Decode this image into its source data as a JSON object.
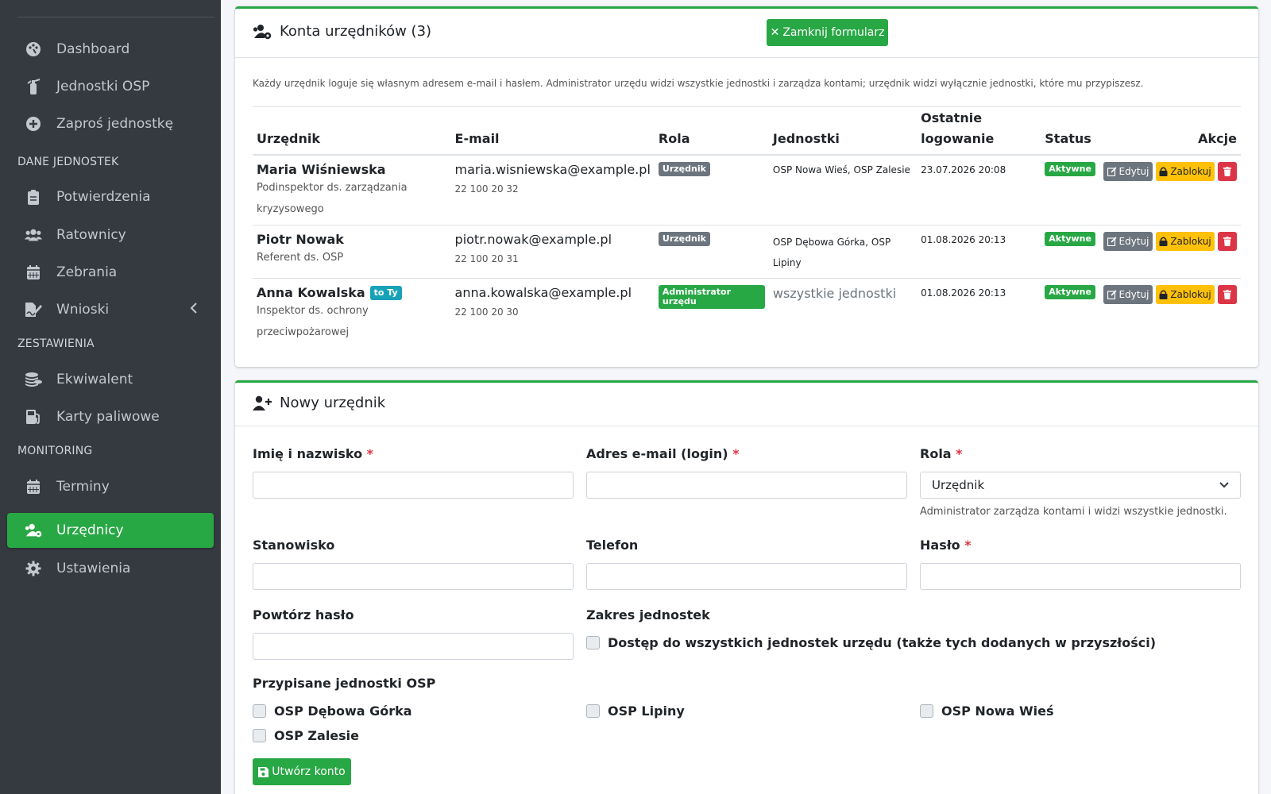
{
  "sidebar": {
    "items": [
      {
        "label": "Dashboard",
        "icon": "palette-icon"
      },
      {
        "label": "Jednostki OSP",
        "icon": "fire-extinguisher-icon"
      },
      {
        "label": "Zaproś jednostkę",
        "icon": "plus-circle-icon"
      },
      {
        "label": "Potwierdzenia",
        "icon": "clipboard-icon"
      },
      {
        "label": "Ratownicy",
        "icon": "users-icon"
      },
      {
        "label": "Zebrania",
        "icon": "calendar-icon"
      },
      {
        "label": "Wnioski",
        "icon": "file-signature-icon"
      },
      {
        "label": "Ekwiwalent",
        "icon": "coins-icon"
      },
      {
        "label": "Karty paliwowe",
        "icon": "gas-pump-icon"
      },
      {
        "label": "Terminy",
        "icon": "calendar-icon"
      },
      {
        "label": "Urzędnicy",
        "icon": "users-cog-icon"
      },
      {
        "label": "Ustawienia",
        "icon": "gear-icon"
      }
    ],
    "headers": [
      "DANE JEDNOSTEK",
      "ZESTAWIENIA",
      "MONITORING"
    ],
    "active_item": "Urzędnicy"
  },
  "accounts_card": {
    "title": "Konta urzędników (3)",
    "close_form_label": "Zamknij formularz",
    "description": "Każdy urzędnik loguje się własnym adresem e-mail i hasłem. Administrator urzędu widzi wszystkie jednostki i zarządza kontami; urzędnik widzi wyłącznie jednostki, które mu przypiszesz.",
    "columns": {
      "official": "Urzędnik",
      "email": "E-mail",
      "role": "Rola",
      "units": "Jednostki",
      "last_login_1": "Ostatnie",
      "last_login_2": "logowanie",
      "status": "Status",
      "actions": "Akcje"
    },
    "rows": [
      {
        "name": "Maria Wiśniewska",
        "position": "Podinspektor ds. zarządzania kryzysowego",
        "email": "maria.wisniewska@example.pl",
        "phone": "22 100 20 32",
        "role": "Urzędnik",
        "units": "OSP Nowa Wieś, OSP Zalesie",
        "last_login": "23.07.2026 20:08",
        "status": "Aktywne"
      },
      {
        "name": "Piotr Nowak",
        "position": "Referent ds. OSP",
        "email": "piotr.nowak@example.pl",
        "phone": "22 100 20 31",
        "role": "Urzędnik",
        "units": "OSP Dębowa Górka, OSP Lipiny",
        "last_login": "01.08.2026 20:13",
        "status": "Aktywne"
      },
      {
        "name": "Anna Kowalska",
        "badge": "to Ty",
        "position": "Inspektor ds. ochrony przeciwpożarowej",
        "email": "anna.kowalska@example.pl",
        "phone": "22 100 20 30",
        "role": "Administrator urzędu",
        "units": "wszystkie jednostki",
        "last_login": "01.08.2026 20:13",
        "status": "Aktywne"
      }
    ],
    "edit_label": "Edytuj",
    "lock_label": "Zablokuj"
  },
  "new_card": {
    "title": "Nowy urzędnik",
    "name_label": "Imię i nazwisko",
    "email_label": "Adres e-mail (login)",
    "role_label": "Rola",
    "role_value": "Urzędnik",
    "role_help": "Administrator zarządza kontami i widzi wszystkie jednostki.",
    "position_label": "Stanowisko",
    "phone_label": "Telefon",
    "password_label": "Hasło",
    "repeat_label": "Powtórz hasło",
    "scope_label": "Zakres jednostek",
    "scope_checkbox": "Dostęp do wszystkich jednostek urzędu (także tych dodanych w przyszłości)",
    "assigned_label": "Przypisane jednostki OSP",
    "units": [
      "OSP Dębowa Górka",
      "OSP Lipiny",
      "OSP Nowa Wieś",
      "OSP Zalesie"
    ],
    "create_label": "Utwórz konto",
    "required_mark": "*"
  },
  "colors": {
    "accent": "#28a745",
    "sidebar_bg": "#343a40",
    "danger": "#dc3545",
    "warning": "#ffc107",
    "secondary": "#6c757d",
    "info": "#17a2b8"
  }
}
